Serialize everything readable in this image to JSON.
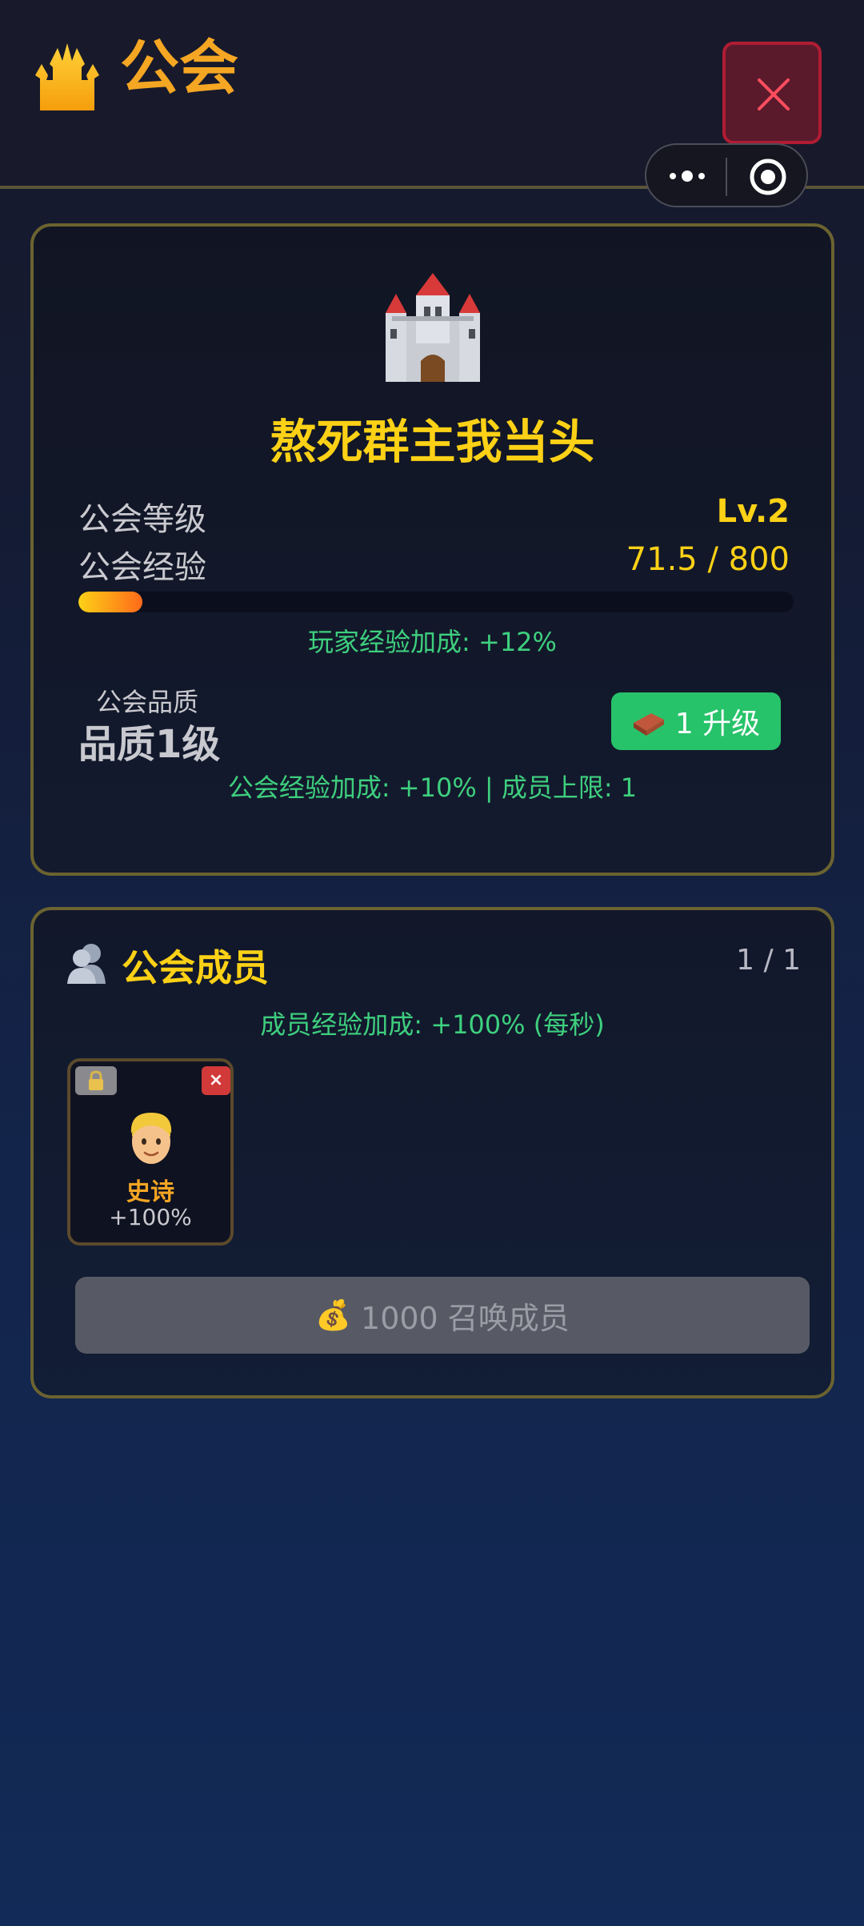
{
  "header": {
    "title": "公会",
    "icon": "crown-icon",
    "close_icon": "close-icon"
  },
  "capsule": {
    "more_icon": "more-dots-icon",
    "target_icon": "target-icon"
  },
  "guild": {
    "icon": "castle-icon",
    "name": "熬死群主我当头",
    "level_label": "公会等级",
    "level_value": "Lv.2",
    "exp_label": "公会经验",
    "exp_value": "71.5 / 800",
    "exp_progress": 0.089,
    "player_bonus": "玩家经验加成: +12%",
    "quality_label": "公会品质",
    "quality_value": "品质1级",
    "upgrade_icon": "brick",
    "upgrade_label": "1 升级",
    "guild_bonus": "公会经验加成: +10% | 成员上限: 1"
  },
  "members": {
    "icon": "members-icon",
    "title": "公会成员",
    "count": "1 / 1",
    "bonus": "成员经验加成: +100% (每秒)",
    "list": [
      {
        "rarity": "史诗",
        "bonus": "+100%",
        "remove_label": "×"
      }
    ],
    "summon_icon": "💰",
    "summon_label": "1000 召唤成员"
  },
  "colors": {
    "accent_gold": "#fcd116",
    "accent_orange": "#f5a623",
    "bonus_green": "#3ecf7e",
    "button_green": "#27c36a",
    "close_red": "#b01c34"
  }
}
